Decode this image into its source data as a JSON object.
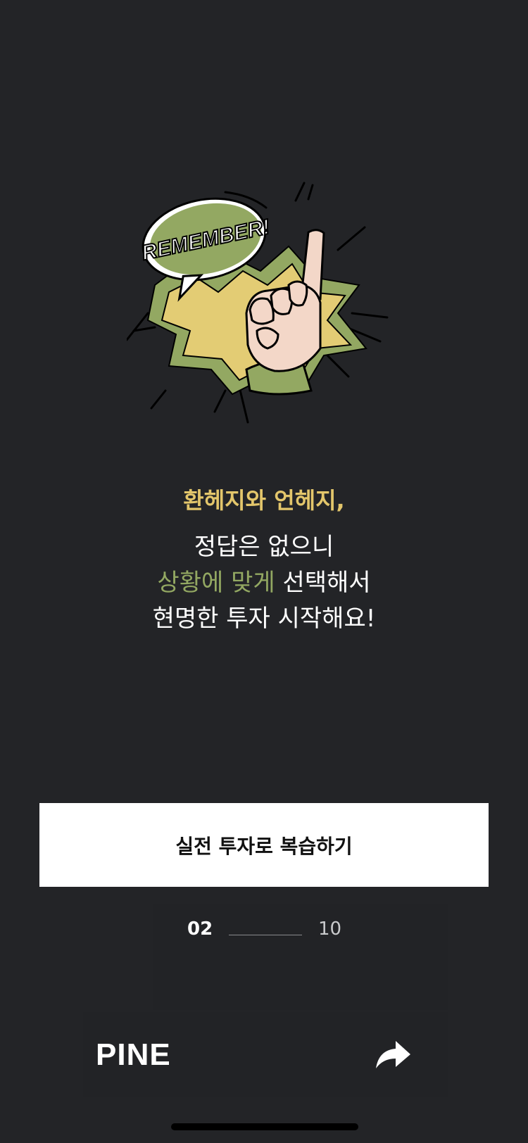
{
  "illustration": {
    "badge_text": "REMEMBER!",
    "icon": "pointing-finger-burst"
  },
  "content": {
    "headline": "환헤지와 언헤지,",
    "line1": "정답은 없으니",
    "line2_highlight": "상황에 맞게",
    "line2_rest": " 선택해서",
    "line3": "현명한 투자 시작해요!"
  },
  "cta": {
    "label": "실전 투자로 복습하기"
  },
  "pager": {
    "current": "02",
    "total": "10"
  },
  "footer": {
    "brand": "PINE",
    "share_icon": "share-arrow-icon"
  },
  "colors": {
    "background": "#232427",
    "headline": "#E3C66B",
    "highlight": "#93A862",
    "button_bg": "#FFFFFF"
  }
}
